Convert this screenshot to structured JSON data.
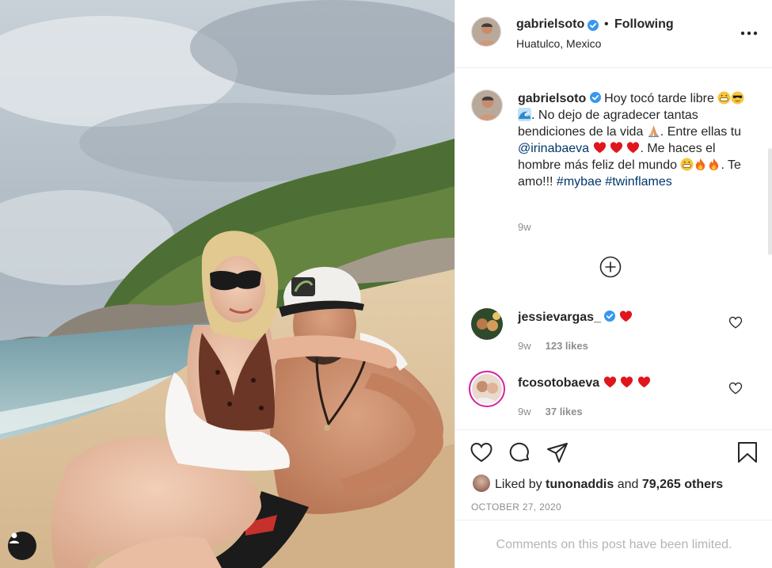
{
  "post": {
    "username": "gabrielsoto",
    "follow_separator": "•",
    "follow_label": "Following",
    "location": "Huatulco, Mexico",
    "caption": {
      "part1": "Hoy tocó tarde libre",
      "part2": ". No dejo de agradecer tantas bendiciones de la vida",
      "part3": ". Entre ellas tu",
      "mention": "@irinabaeva",
      "part4": ". Me haces el hombre más feliz del mundo",
      "part5": ". Te amo!!!",
      "hashtag1": "#mybae",
      "hashtag2": "#twinflames"
    },
    "caption_time": "9w"
  },
  "comments": [
    {
      "username": "jessievargas_",
      "verified": true,
      "time": "9w",
      "likes": "123 likes"
    },
    {
      "username": "fcosotobaeva",
      "verified": false,
      "time": "9w",
      "likes": "37 likes"
    }
  ],
  "likes": {
    "prefix": "Liked by",
    "user": "tunonaddis",
    "connector": "and",
    "others": "79,265 others"
  },
  "date": "OCTOBER 27, 2020",
  "comments_limited": "Comments on this post have been limited.",
  "icons": {
    "verified": "verified-badge-icon",
    "more": "more-options-icon",
    "add": "plus-circle-icon",
    "heart": "heart-icon",
    "comment": "comment-icon",
    "share": "paper-plane-icon",
    "save": "bookmark-icon",
    "user": "user-icon"
  },
  "colors": {
    "verified_blue": "#3897f0",
    "link": "#00376b",
    "muted": "#8e8e8e",
    "heart_red": "#ed4956"
  }
}
